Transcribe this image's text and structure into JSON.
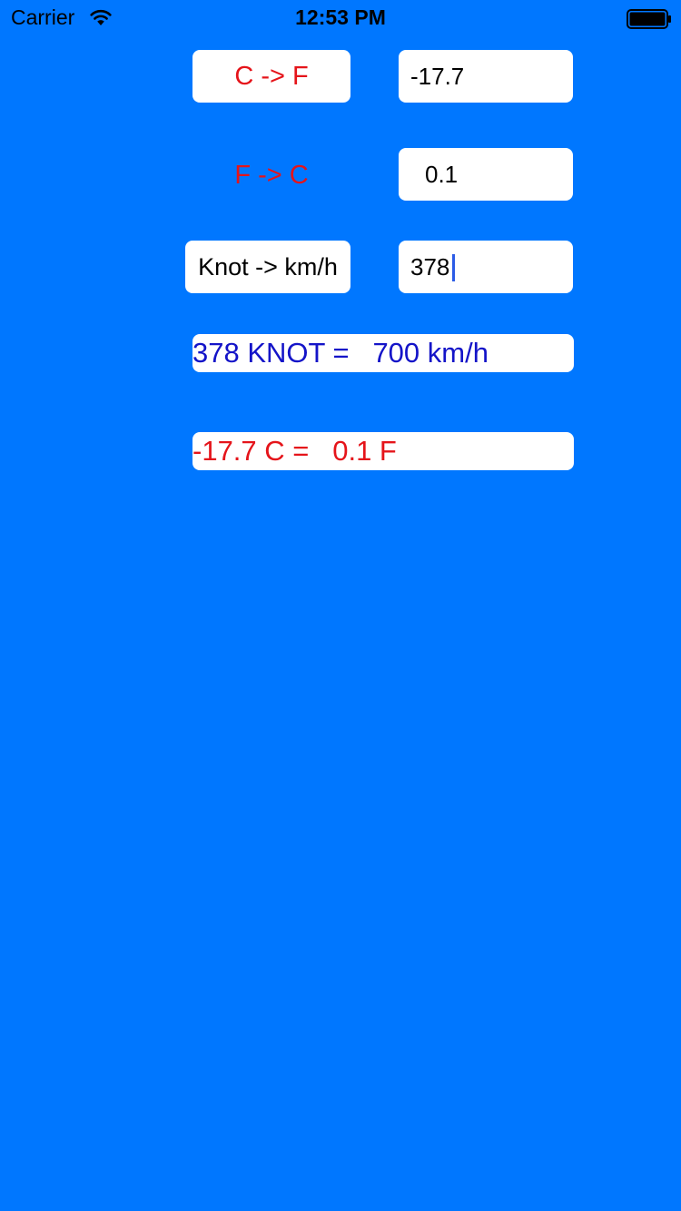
{
  "status_bar": {
    "carrier": "Carrier",
    "time": "12:53 PM",
    "wifi_icon": "wifi-icon",
    "battery_icon": "battery-icon"
  },
  "buttons": {
    "c_to_f": "C -> F",
    "f_to_c": "F -> C",
    "knot_to_kmh": "Knot -> km/h"
  },
  "inputs": {
    "celsius_value": "-17.7",
    "fahrenheit_value": "0.1",
    "knot_value": "378"
  },
  "results": {
    "knot_result": "378 KNOT =   700 km/h",
    "temperature_result": "-17.7 C =   0.1 F"
  },
  "colors": {
    "background": "#0077FF",
    "button_text_red": "#E5141A",
    "result_blue": "#1414C8",
    "cursor": "#2B5BE6"
  }
}
